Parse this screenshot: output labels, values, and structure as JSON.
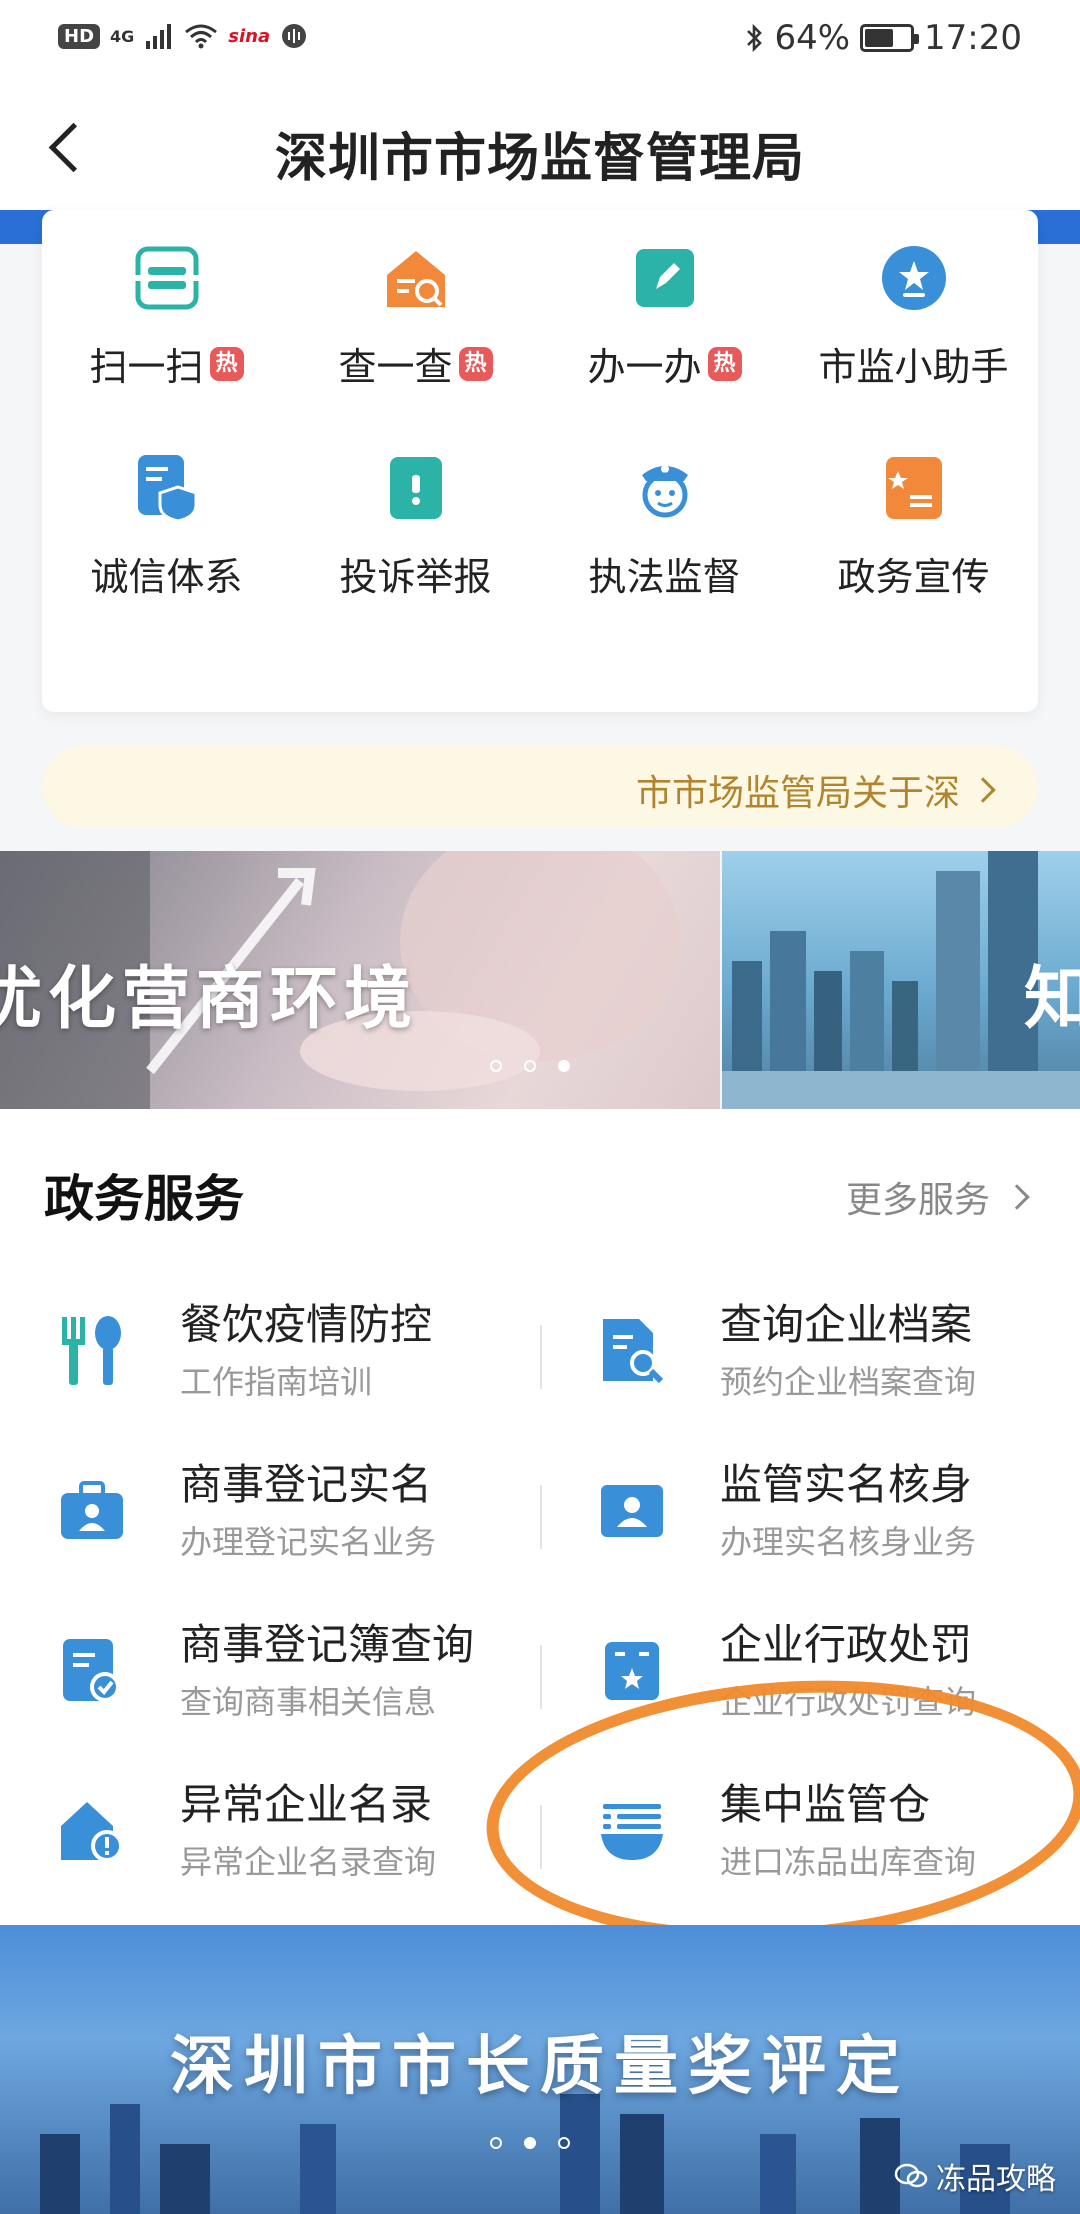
{
  "status_bar": {
    "left_badges": [
      "HD",
      "4G"
    ],
    "app_badge": "sina",
    "battery": "64%",
    "battery_level": 0.64,
    "time": "17:20"
  },
  "header": {
    "title": "深圳市市场监督管理局"
  },
  "quick_grid": {
    "items": [
      {
        "label": "扫一扫",
        "hot": "热",
        "icon": "scan-icon"
      },
      {
        "label": "查一查",
        "hot": "热",
        "icon": "house-search-icon"
      },
      {
        "label": "办一办",
        "hot": "热",
        "icon": "edit-icon"
      },
      {
        "label": "市监小助手",
        "icon": "star-badge-icon"
      },
      {
        "label": "诚信体系",
        "icon": "shield-doc-icon"
      },
      {
        "label": "投诉举报",
        "icon": "report-icon"
      },
      {
        "label": "执法监督",
        "icon": "officer-icon"
      },
      {
        "label": "政务宣传",
        "icon": "promo-doc-icon"
      }
    ]
  },
  "notice": {
    "text": "市市场监管局关于深"
  },
  "banner1": {
    "left_text": "优化营商环境",
    "right_text": "知"
  },
  "services": {
    "title": "政务服务",
    "more": "更多服务",
    "items": [
      {
        "name": "餐饮疫情防控",
        "sub": "工作指南培训",
        "icon": "fork-spoon-icon"
      },
      {
        "name": "查询企业档案",
        "sub": "预约企业档案查询",
        "icon": "doc-search-icon"
      },
      {
        "name": "商事登记实名",
        "sub": "办理登记实名业务",
        "icon": "id-briefcase-icon"
      },
      {
        "name": "监管实名核身",
        "sub": "办理实名核身业务",
        "icon": "id-card-icon"
      },
      {
        "name": "商事登记簿查询",
        "sub": "查询商事相关信息",
        "icon": "doc-check-icon"
      },
      {
        "name": "企业行政处罚",
        "sub": "企业行政处罚查询",
        "icon": "penalty-icon"
      },
      {
        "name": "异常企业名录",
        "sub": "异常企业名录查询",
        "icon": "warning-house-icon"
      },
      {
        "name": "集中监管仓",
        "sub": "进口冻品出库查询",
        "icon": "bowl-icon"
      }
    ]
  },
  "banner2": {
    "text": "深圳市市长质量奖评定"
  },
  "watermark": {
    "text": "冻品攻略"
  },
  "colors": {
    "accent": "#2a6fd6",
    "icon_blue": "#3a8fd9",
    "icon_orange": "#f2893a",
    "hot_red": "#e85a5a",
    "notice_text": "#b1852f",
    "circle": "#f08a2c"
  }
}
